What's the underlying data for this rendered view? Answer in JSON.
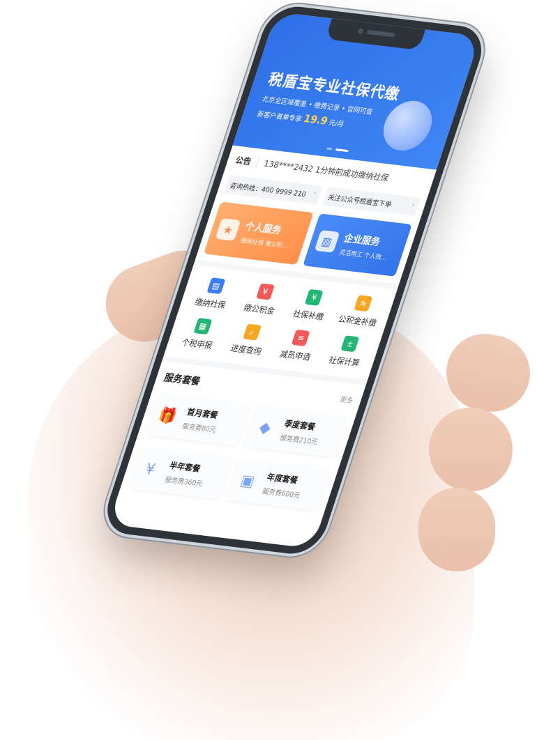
{
  "banner": {
    "title": "税盾宝专业社保代缴",
    "subtitle": "北京全区域覆盖 • 缴费记录 • 官网可查",
    "promo_prefix": "新客户首单专享",
    "promo_price": "19.9",
    "promo_suffix": "元/月"
  },
  "notice": {
    "label": "公告",
    "text": "138****2432  1分钟前成功缴纳社保"
  },
  "info": {
    "hotline": "咨询热线：400 9999 210",
    "follow": "关注公众号税盾宝下单"
  },
  "services": {
    "personal": {
      "title": "个人服务",
      "desc": "缴纳社保    缴公积..."
    },
    "company": {
      "title": "企业服务",
      "desc": "灵活用工    个人独..."
    }
  },
  "grid": [
    {
      "label": "缴纳社保",
      "icon": "id-card-icon",
      "color": "#3d7ef5"
    },
    {
      "label": "缴公积金",
      "icon": "wallet-yen-icon",
      "color": "#f25a5a"
    },
    {
      "label": "社保补缴",
      "icon": "cash-yen-icon",
      "color": "#22b573"
    },
    {
      "label": "公积金补缴",
      "icon": "coins-icon",
      "color": "#f5a623"
    },
    {
      "label": "个税申报",
      "icon": "tax-form-icon",
      "color": "#22b573"
    },
    {
      "label": "进度查询",
      "icon": "search-doc-icon",
      "color": "#f5a623"
    },
    {
      "label": "减员申请",
      "icon": "doc-list-icon",
      "color": "#f25a5a"
    },
    {
      "label": "社保计算",
      "icon": "calculator-icon",
      "color": "#22b573"
    }
  ],
  "packages": {
    "title": "服务套餐",
    "more": "更多",
    "items": [
      {
        "name": "首月套餐",
        "price": "服务费80元",
        "icon": "gift-icon"
      },
      {
        "name": "季度套餐",
        "price": "服务费210元",
        "icon": "diamond-icon"
      },
      {
        "name": "半年套餐",
        "price": "服务费360元",
        "icon": "money-bag-icon"
      },
      {
        "name": "年度套餐",
        "price": "服务费600元",
        "icon": "gift-box-icon"
      }
    ]
  }
}
